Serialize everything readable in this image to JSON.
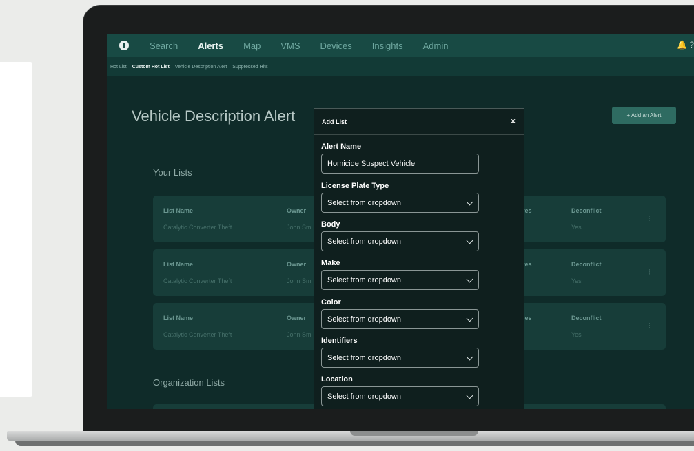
{
  "nav": {
    "items": [
      "Search",
      "Alerts",
      "Map",
      "VMS",
      "Devices",
      "Insights",
      "Admin"
    ],
    "active": "Alerts",
    "right_icons": "🔔 ?"
  },
  "subnav": {
    "items": [
      "Hot List",
      "Custom Hot List",
      "Vehicle Description Alert",
      "Suppressed Hits"
    ],
    "active": "Custom Hot List"
  },
  "page": {
    "title": "Vehicle Description Alert",
    "add_button": "+ Add an Alert",
    "your_lists_title": "Your Lists",
    "org_lists_title": "Organization Lists"
  },
  "lists": [
    {
      "list_name_label": "List Name",
      "list_name": "Catalytic Converter Theft",
      "owner_label": "Owner",
      "owner": "John Sm",
      "col3_label": "res",
      "deconflict_label": "Deconflict",
      "deconflict": "Yes"
    },
    {
      "list_name_label": "List Name",
      "list_name": "Catalytic Converter Theft",
      "owner_label": "Owner",
      "owner": "John Sm",
      "col3_label": "res",
      "deconflict_label": "Deconflict",
      "deconflict": "Yes"
    },
    {
      "list_name_label": "List Name",
      "list_name": "Catalytic Converter Theft",
      "owner_label": "Owner",
      "owner": "John Sm",
      "col3_label": "res",
      "deconflict_label": "Deconflict",
      "deconflict": "Yes"
    }
  ],
  "modal": {
    "title": "Add List",
    "close": "×",
    "alert_name_label": "Alert Name",
    "alert_name_value": "Homicide Suspect Vehicle",
    "fields": [
      {
        "label": "License Plate Type",
        "value": "Select from dropdown"
      },
      {
        "label": "Body",
        "value": "Select from dropdown"
      },
      {
        "label": "Make",
        "value": "Select from dropdown"
      },
      {
        "label": "Color",
        "value": "Select from dropdown"
      },
      {
        "label": "Identifiers",
        "value": "Select from dropdown"
      },
      {
        "label": "Location",
        "value": "Select from dropdown"
      }
    ]
  }
}
